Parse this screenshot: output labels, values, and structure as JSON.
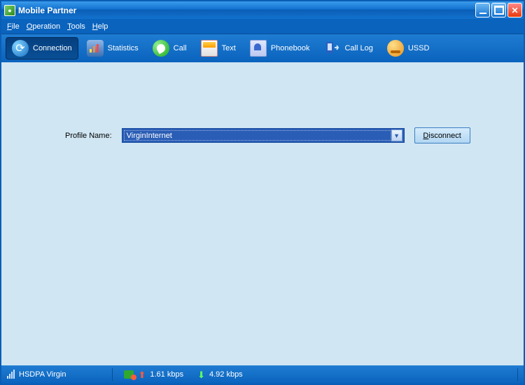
{
  "title": "Mobile Partner",
  "menus": {
    "file": "File",
    "operation": "Operation",
    "tools": "Tools",
    "help": "Help"
  },
  "toolbar": {
    "connection": "Connection",
    "statistics": "Statistics",
    "call": "Call",
    "text": "Text",
    "phonebook": "Phonebook",
    "calllog": "Call Log",
    "ussd": "USSD"
  },
  "profile": {
    "label": "Profile Name:",
    "selected": "VirginInternet",
    "disconnect": "Disconnect"
  },
  "status": {
    "network": "HSDPA  Virgin",
    "up": "1.61 kbps",
    "down": "4.92 kbps"
  }
}
